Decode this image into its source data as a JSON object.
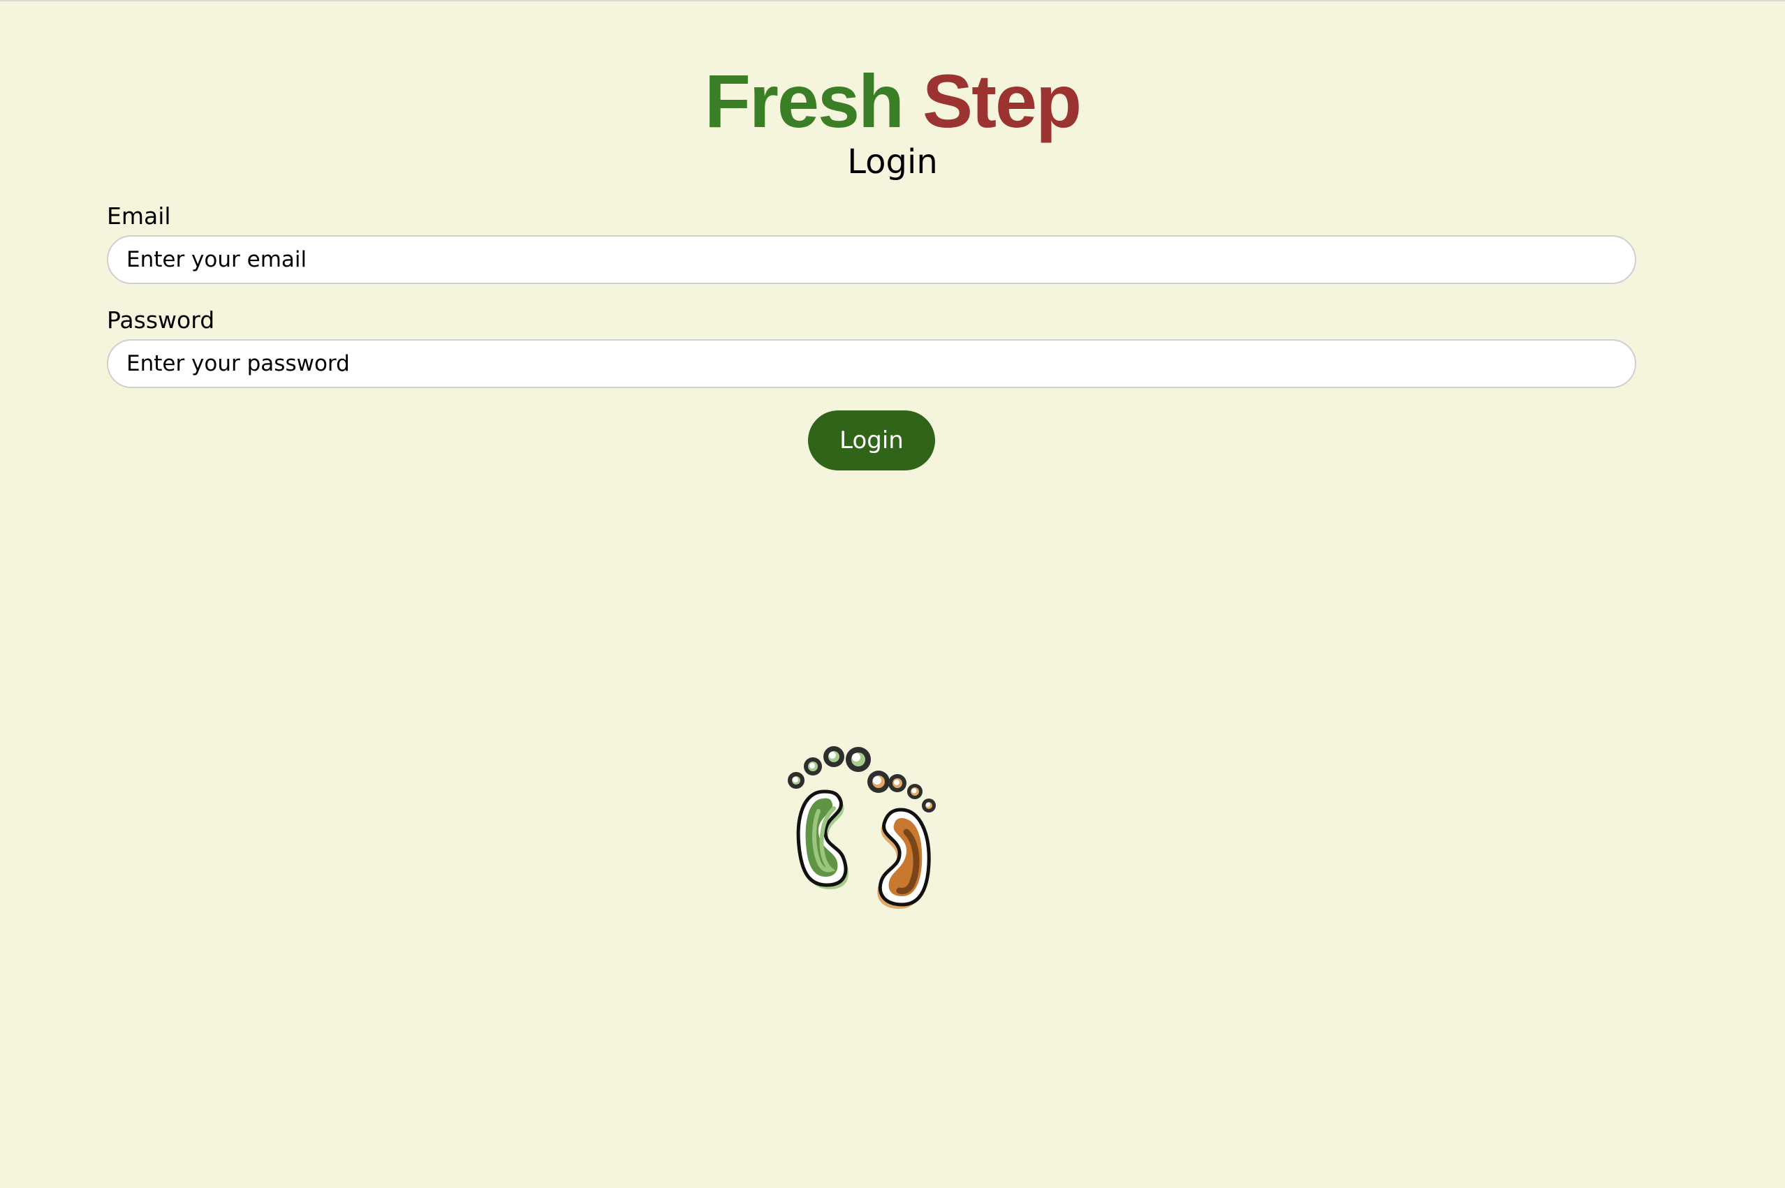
{
  "brand": {
    "word1": "Fresh",
    "word2": "Step",
    "word1_color": "#3a7e26",
    "word2_color": "#9b3430"
  },
  "page": {
    "title": "Login"
  },
  "form": {
    "email_label": "Email",
    "email_placeholder": "Enter your email",
    "email_value": "",
    "password_label": "Password",
    "password_placeholder": "Enter your password",
    "password_value": "",
    "submit_label": "Login"
  },
  "colors": {
    "background": "#f5f4dd",
    "button": "#2f6419",
    "input_background": "#ffffff",
    "input_border": "#cfcfcf"
  },
  "logo": {
    "icon": "footprints-icon",
    "left_foot_color": "#6a9e4f",
    "right_foot_color": "#c9792f"
  }
}
